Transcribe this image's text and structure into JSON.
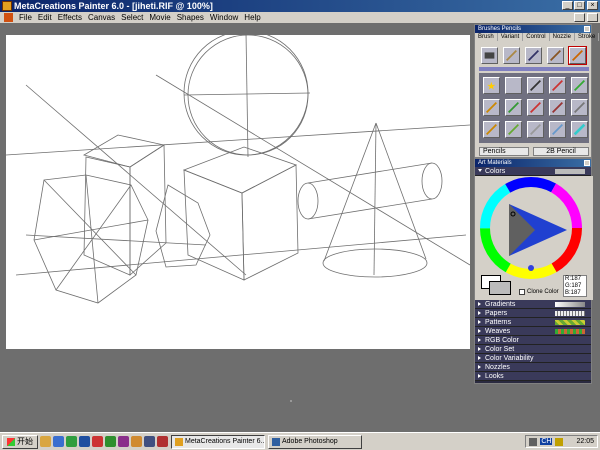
{
  "window": {
    "title": "MetaCreations Painter 6.0 - [jiheti.RIF @ 100%]",
    "controls": {
      "minimize": "_",
      "maximize": "□",
      "close": "×"
    }
  },
  "menubar": {
    "items": [
      "File",
      "Edit",
      "Effects",
      "Canvas",
      "Select",
      "Movie",
      "Shapes",
      "Window",
      "Help"
    ]
  },
  "brushes_palette": {
    "title": "Brushes Pencils",
    "tabs": [
      "Brush",
      "Variant",
      "Control",
      "Nozzle",
      "Stroke"
    ],
    "category": "Pencils",
    "variant": "2B Pencil"
  },
  "art_materials": {
    "title": "Art Materials",
    "colors_label": "Colors",
    "clone_color_label": "Clone Color",
    "rgb_readout": [
      "R:187",
      "G:187",
      "B:187"
    ],
    "sections": [
      "Gradients",
      "Papers",
      "Patterns",
      "Weaves",
      "RGB Color",
      "Color Set",
      "Color Variability",
      "Nozzles",
      "Looks"
    ]
  },
  "taskbar": {
    "start_label": "开始",
    "tasks": [
      "MetaCreations Painter 6....",
      "Adobe Photoshop"
    ],
    "tray_ime": "CH",
    "clock": "22:05"
  },
  "colors": {
    "title_bar": "#0a246a",
    "panel_bg": "#d4d0c8",
    "workspace_bg": "#6e6e6e",
    "section_row": "#3a3a5a"
  }
}
